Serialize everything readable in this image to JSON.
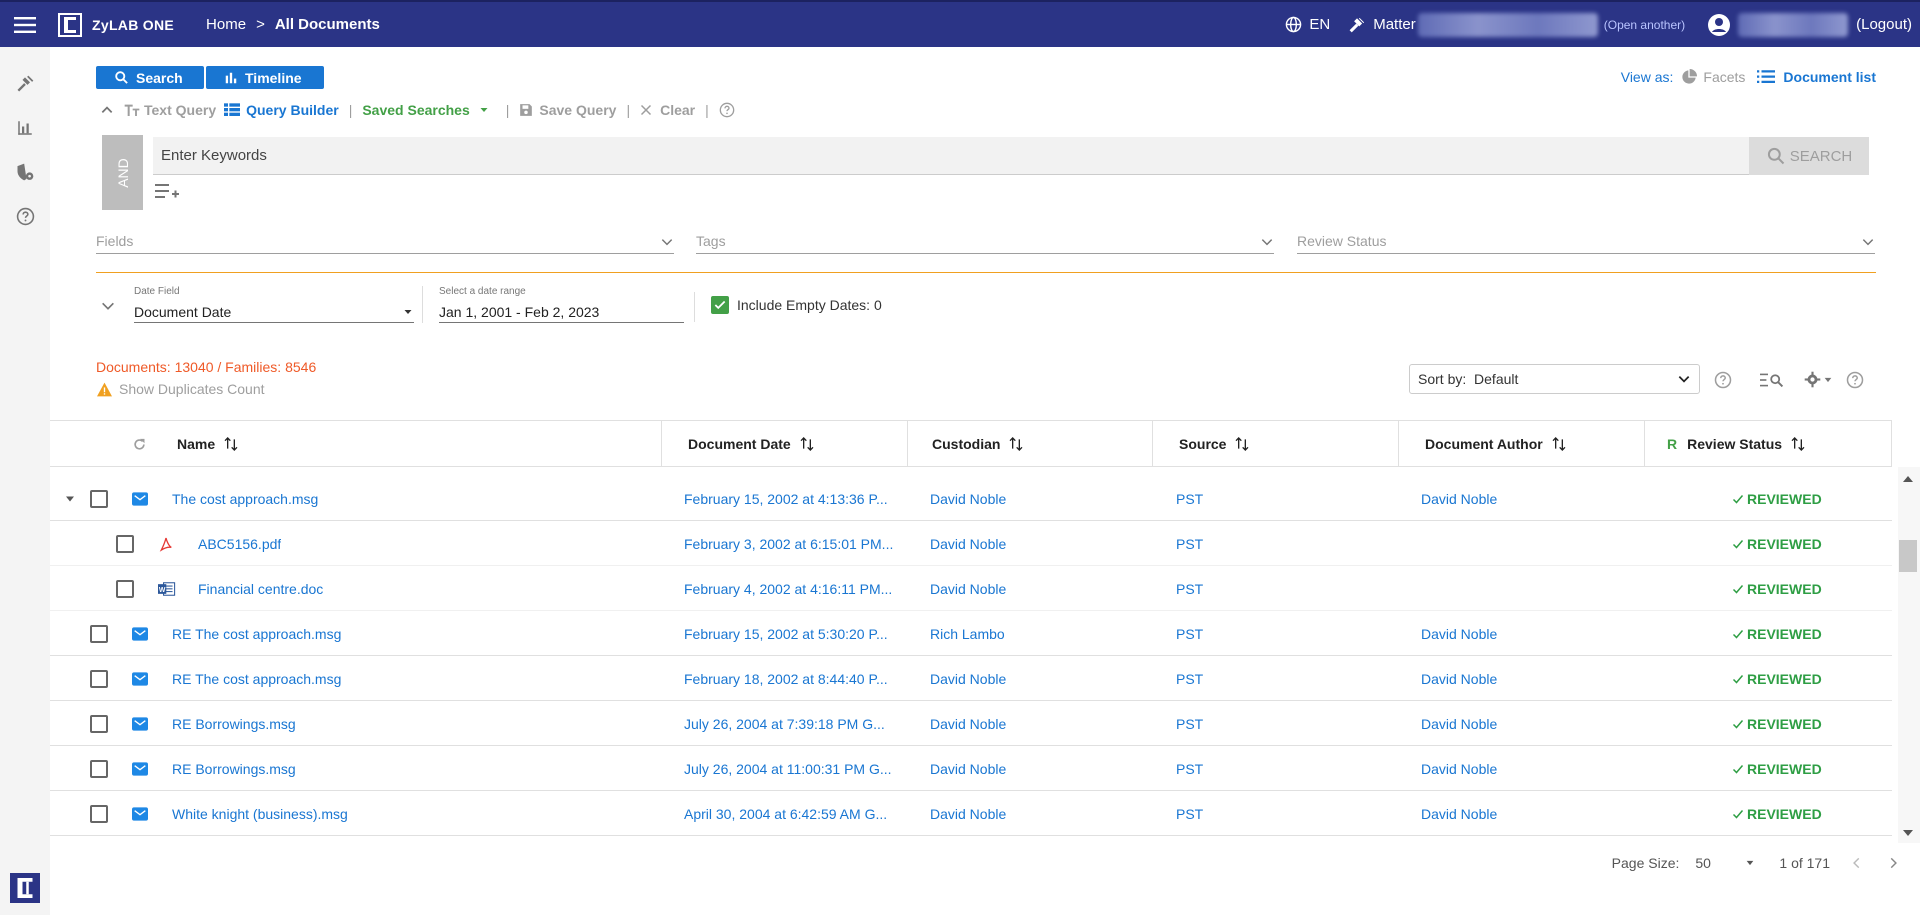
{
  "topbar": {
    "brand": "ZyLAB ONE",
    "breadcrumb_home": "Home",
    "breadcrumb_sep": ">",
    "breadcrumb_current": "All Documents",
    "language": "EN",
    "matter_label": "Matter",
    "open_another": "(Open another)",
    "logout": "(Logout)"
  },
  "sidebar": {
    "items": [
      {
        "icon": "hammer-icon"
      },
      {
        "icon": "bar-chart-icon"
      },
      {
        "icon": "shield-gear-icon"
      },
      {
        "icon": "help-icon"
      }
    ]
  },
  "search_tabs": {
    "search_label": "Search",
    "timeline_label": "Timeline"
  },
  "view_as": {
    "label": "View as:",
    "facets_label": "Facets",
    "document_list_label": "Document list"
  },
  "query_toolbar": {
    "text_query": "Text Query",
    "query_builder": "Query Builder",
    "saved_searches": "Saved Searches",
    "save_query": "Save Query",
    "clear": "Clear"
  },
  "query": {
    "operator": "AND",
    "keywords_placeholder": "Enter Keywords",
    "search_button": "SEARCH"
  },
  "filters": {
    "fields": "Fields",
    "tags": "Tags",
    "review_status": "Review Status"
  },
  "date_filter": {
    "field_label": "Date Field",
    "field_value": "Document Date",
    "range_label": "Select a date range",
    "range_value": "Jan 1, 2001 - Feb 2, 2023",
    "include_empty": "Include Empty Dates: 0"
  },
  "results": {
    "counts": "Documents: 13040 / Families: 8546",
    "show_duplicates": "Show Duplicates Count",
    "sort_label": "Sort by:",
    "sort_value": "Default"
  },
  "table": {
    "columns": {
      "name": "Name",
      "document_date": "Document Date",
      "custodian": "Custodian",
      "source": "Source",
      "document_author": "Document Author",
      "review_status_prefix": "R",
      "review_status": "Review Status"
    },
    "rows": [
      {
        "name": "The cost approach.msg",
        "date": "February 15, 2002 at 4:13:36 P...",
        "custodian": "David Noble",
        "source": "PST",
        "author": "David Noble",
        "status": "REVIEWED",
        "type": "email"
      },
      {
        "name": "ABC5156.pdf",
        "date": "February 3, 2002 at 6:15:01 PM...",
        "custodian": "David Noble",
        "source": "PST",
        "author": "",
        "status": "REVIEWED",
        "type": "pdf"
      },
      {
        "name": "Financial centre.doc",
        "date": "February 4, 2002 at 4:16:11 PM...",
        "custodian": "David Noble",
        "source": "PST",
        "author": "",
        "status": "REVIEWED",
        "type": "word"
      },
      {
        "name": "RE The cost approach.msg",
        "date": "February 15, 2002 at 5:30:20 P...",
        "custodian": "Rich Lambo",
        "source": "PST",
        "author": "David Noble",
        "status": "REVIEWED",
        "type": "email"
      },
      {
        "name": "RE The cost approach.msg",
        "date": "February 18, 2002 at 8:44:40 P...",
        "custodian": "David Noble",
        "source": "PST",
        "author": "David Noble",
        "status": "REVIEWED",
        "type": "email"
      },
      {
        "name": "RE Borrowings.msg",
        "date": "July 26, 2004 at 7:39:18 PM G...",
        "custodian": "David Noble",
        "source": "PST",
        "author": "David Noble",
        "status": "REVIEWED",
        "type": "email"
      },
      {
        "name": "RE Borrowings.msg",
        "date": "July 26, 2004 at 11:00:31 PM G...",
        "custodian": "David Noble",
        "source": "PST",
        "author": "David Noble",
        "status": "REVIEWED",
        "type": "email"
      },
      {
        "name": "White knight (business).msg",
        "date": "April 30, 2004 at 6:42:59 AM G...",
        "custodian": "David Noble",
        "source": "PST",
        "author": "David Noble",
        "status": "REVIEWED",
        "type": "email"
      }
    ]
  },
  "pager": {
    "page_size_label": "Page Size:",
    "page_size": "50",
    "page_info": "1 of 171"
  }
}
